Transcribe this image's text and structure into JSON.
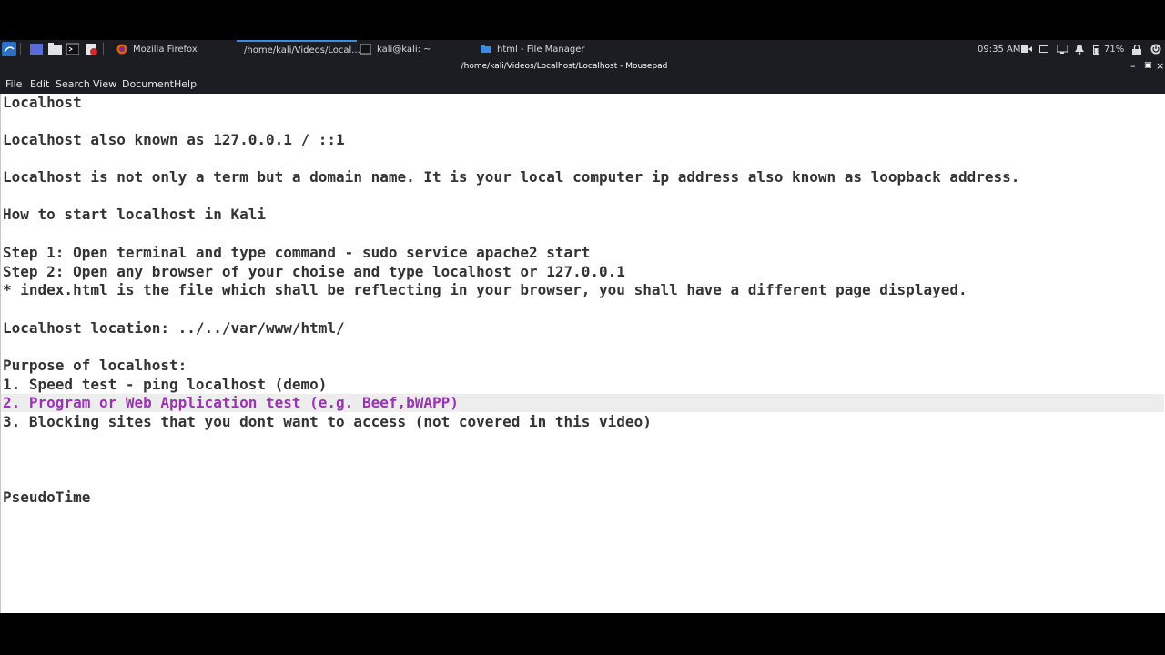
{
  "panel": {
    "tasks": [
      {
        "label": "Mozilla Firefox",
        "icon": "firefox-icon"
      },
      {
        "label": "/home/kali/Videos/Local...",
        "icon": "text-editor-icon"
      },
      {
        "label": "kali@kali: ~",
        "icon": "terminal-icon"
      },
      {
        "label": "html - File Manager",
        "icon": "folder-icon"
      }
    ],
    "clock": "09:35 AM",
    "battery": "71%"
  },
  "window": {
    "title": "/home/kali/Videos/Localhost/Localhost - Mousepad"
  },
  "menu": [
    "File",
    "Edit",
    "Search",
    "View",
    "Document",
    "Help"
  ],
  "editor": {
    "lines": [
      "Localhost",
      "",
      "Localhost also known as 127.0.0.1 / ::1",
      "",
      "Localhost is not only a term but a domain name. It is your local computer ip address also known as loopback address.",
      "",
      "How to start localhost in Kali",
      "",
      "Step 1: Open terminal and type command - sudo service apache2 start",
      "Step 2: Open any browser of your choise and type localhost or 127.0.0.1",
      "* index.html is the file which shall be reflecting in your browser, you shall have a different page displayed.",
      "",
      "Localhost location: ../../var/www/html/",
      "",
      "Purpose of localhost:",
      "1. Speed test - ping localhost (demo)",
      "2. Program or Web Application test (e.g. Beef,bWAPP)",
      "3. Blocking sites that you dont want to access (not covered in this video)",
      "",
      "",
      "",
      "PseudoTime"
    ],
    "highlight_color": "#9a32b4"
  }
}
